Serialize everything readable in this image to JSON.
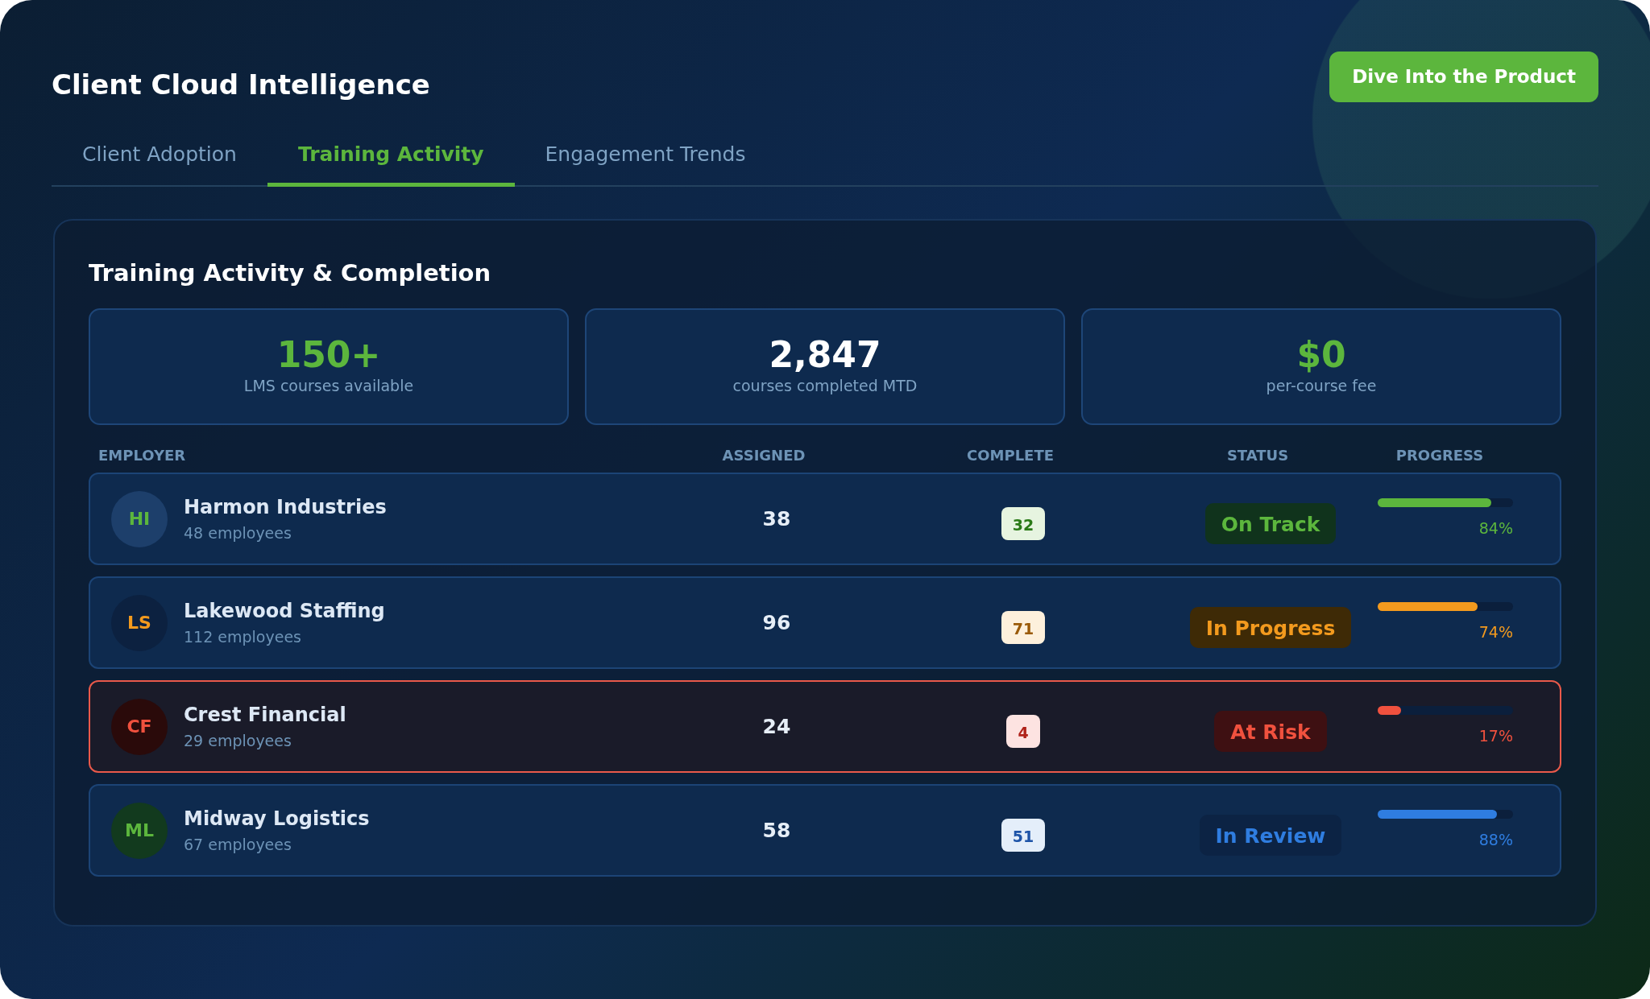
{
  "header": {
    "title": "Client Cloud Intelligence",
    "cta_button": "Dive Into the Product"
  },
  "tabs": [
    {
      "label": "Client Adoption",
      "selected": false
    },
    {
      "label": "Training Activity",
      "selected": true
    },
    {
      "label": "Engagement Trends",
      "selected": false
    }
  ],
  "panel": {
    "title": "Training Activity & Completion",
    "stats": [
      {
        "value": "150+",
        "label": "LMS courses available",
        "kind": "accent"
      },
      {
        "value": "2,847",
        "label": "courses completed MTD",
        "kind": "plain"
      },
      {
        "value": "$0",
        "label": "per-course fee",
        "kind": "accent"
      }
    ],
    "table": {
      "columns": [
        "EMPLOYER",
        "ASSIGNED",
        "COMPLETE",
        "STATUS",
        "PROGRESS"
      ],
      "rows": [
        {
          "initials": "HI",
          "name": "Harmon Industries",
          "employees": "48 employees",
          "assigned": "38",
          "complete": "32",
          "status": "On Track",
          "kind": "on_track",
          "level": 0.84,
          "percent": "84%"
        },
        {
          "initials": "LS",
          "name": "Lakewood Staffing",
          "employees": "112 employees",
          "assigned": "96",
          "complete": "71",
          "status": "In Progress",
          "kind": "in_progress",
          "level": 0.74,
          "percent": "74%"
        },
        {
          "initials": "CF",
          "name": "Crest Financial",
          "employees": "29 employees",
          "assigned": "24",
          "complete": "4",
          "status": "At Risk",
          "kind": "at_risk",
          "level": 0.17,
          "percent": "17%"
        },
        {
          "initials": "ML",
          "name": "Midway Logistics",
          "employees": "67 employees",
          "assigned": "58",
          "complete": "51",
          "status": "In Review",
          "kind": "in_review",
          "level": 0.88,
          "percent": "88%"
        }
      ]
    }
  }
}
